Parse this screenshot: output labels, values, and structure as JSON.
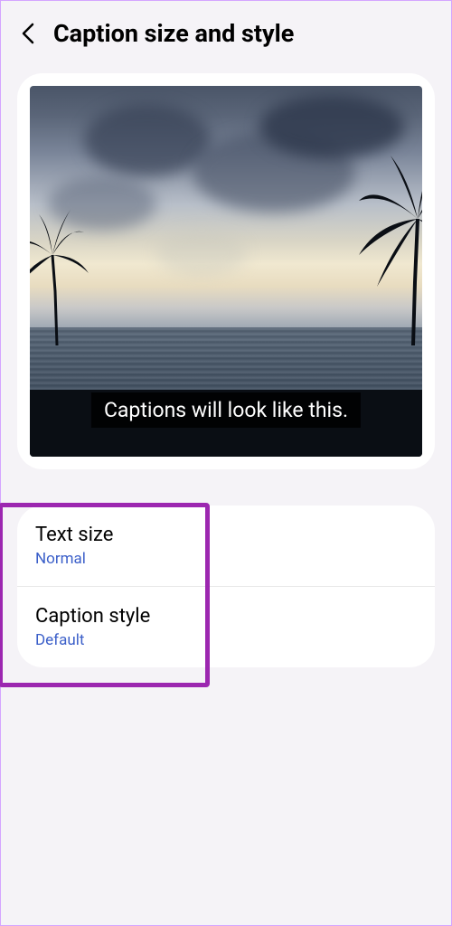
{
  "header": {
    "title": "Caption size and style"
  },
  "preview": {
    "caption_text": "Captions will look like this."
  },
  "settings": {
    "items": [
      {
        "label": "Text size",
        "value": "Normal"
      },
      {
        "label": "Caption style",
        "value": "Default"
      }
    ]
  }
}
